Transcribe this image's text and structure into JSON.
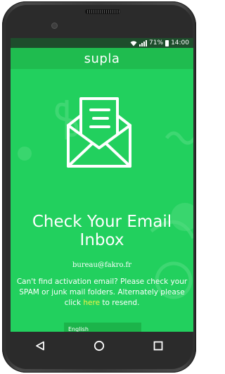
{
  "status_bar": {
    "battery": "71%",
    "time": "14:00"
  },
  "app_bar": {
    "title": "supla"
  },
  "content": {
    "icon": "envelope-with-letter-icon",
    "heading": "Check Your Email Inbox",
    "email": "bureau@fakro.fr",
    "message_before_link": "Can't find activation email? Please check your SPAM or junk mail folders. Alternately please click ",
    "link_text": "here",
    "message_after_link": " to resend."
  },
  "language_select": {
    "selected": "English"
  },
  "nav_bar": {
    "back": "back-triangle-icon",
    "home": "home-circle-icon",
    "recents": "recents-square-icon"
  },
  "colors": {
    "accent": "#22d05e",
    "app_bar": "#1fbc4f",
    "status_bar": "#1e4d2c",
    "link": "#f2f24a"
  }
}
